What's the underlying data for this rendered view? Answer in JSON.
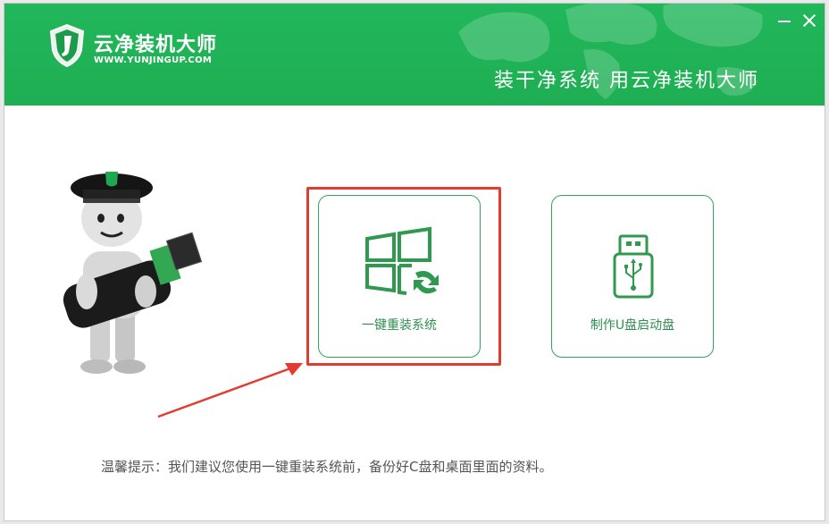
{
  "header": {
    "app_title": "云净装机大师",
    "app_url": "WWW.YUNJINGUP.COM",
    "slogan": "装干净系统  用云净装机大师",
    "accent_color": "#21b75a"
  },
  "window_controls": {
    "minimize_icon": "minimize-icon",
    "close_icon": "close-icon"
  },
  "cards": {
    "reinstall": {
      "label": "一键重装系统",
      "icon": "windows-refresh-icon"
    },
    "usb": {
      "label": "制作U盘启动盘",
      "icon": "usb-drive-icon"
    }
  },
  "highlight_color": "#e53b2e",
  "tip": {
    "text": "温馨提示：我们建议您使用一键重装系统前，备份好C盘和桌面里面的资料。"
  }
}
